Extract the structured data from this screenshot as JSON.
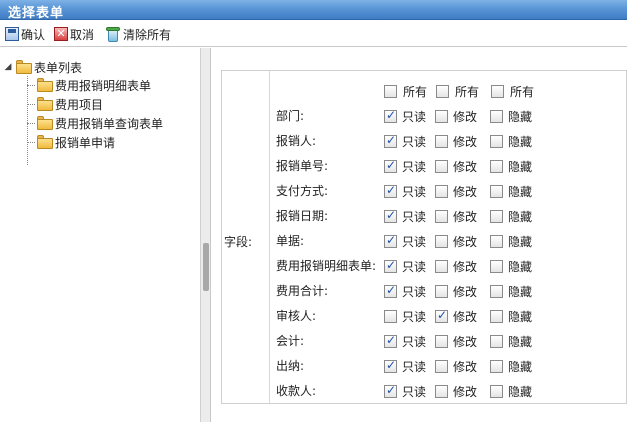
{
  "window": {
    "title": "选择表单"
  },
  "toolbar": {
    "confirm_label": "确认",
    "cancel_label": "取消",
    "clear_label": "清除所有",
    "icons": [
      "save-icon",
      "cancel-icon",
      "recycle-bin-icon"
    ]
  },
  "tree": {
    "root_label": "表单列表",
    "items": [
      {
        "label": "费用报销明细表单"
      },
      {
        "label": "费用项目"
      },
      {
        "label": "费用报销单查询表单"
      },
      {
        "label": "报销单申请"
      }
    ]
  },
  "form": {
    "field_label": "字段:",
    "headers": [
      {
        "label": "所有",
        "checked": false
      },
      {
        "label": "所有",
        "checked": false
      },
      {
        "label": "所有",
        "checked": false
      }
    ],
    "option_labels": [
      "只读",
      "修改",
      "隐藏"
    ],
    "rows": [
      {
        "label": "部门:",
        "options": [
          true,
          false,
          false
        ]
      },
      {
        "label": "报销人:",
        "options": [
          true,
          false,
          false
        ]
      },
      {
        "label": "报销单号:",
        "options": [
          true,
          false,
          false
        ]
      },
      {
        "label": "支付方式:",
        "options": [
          true,
          false,
          false
        ]
      },
      {
        "label": "报销日期:",
        "options": [
          true,
          false,
          false
        ]
      },
      {
        "label": "单据:",
        "options": [
          true,
          false,
          false
        ]
      },
      {
        "label": "费用报销明细表单:",
        "options": [
          true,
          false,
          false
        ]
      },
      {
        "label": "费用合计:",
        "options": [
          true,
          false,
          false
        ]
      },
      {
        "label": "审核人:",
        "options": [
          false,
          true,
          false
        ]
      },
      {
        "label": "会计:",
        "options": [
          true,
          false,
          false
        ]
      },
      {
        "label": "出纳:",
        "options": [
          true,
          false,
          false
        ]
      },
      {
        "label": "收款人:",
        "options": [
          true,
          false,
          false
        ]
      }
    ]
  },
  "colors": {
    "titlebar": "#5a95d6",
    "check": "#1e4fa8"
  }
}
